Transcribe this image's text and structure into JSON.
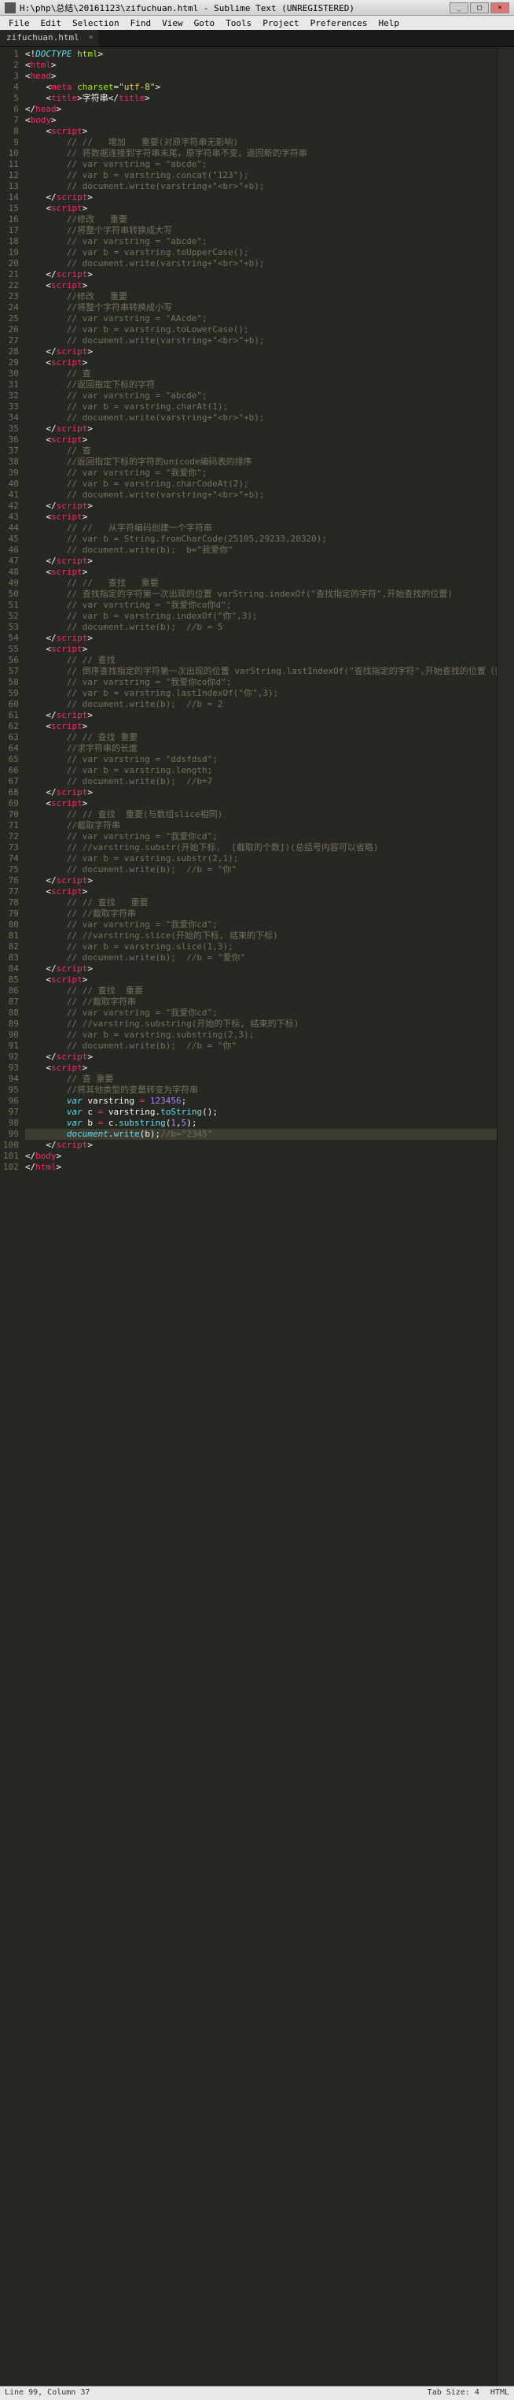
{
  "titlebar": {
    "title": "H:\\php\\总结\\20161123\\zifuchuan.html - Sublime Text (UNREGISTERED)"
  },
  "window_controls": {
    "min": "_",
    "max": "□",
    "close": "×"
  },
  "menu": [
    "File",
    "Edit",
    "Selection",
    "Find",
    "View",
    "Goto",
    "Tools",
    "Project",
    "Preferences",
    "Help"
  ],
  "tab": {
    "name": "zifuchuan.html",
    "close": "×"
  },
  "code": {
    "lines": [
      {
        "n": 1,
        "html": "<span class='t-pun'>&lt;!</span><span class='t-doc'>DOCTYPE</span> <span class='t-attr'>html</span><span class='t-pun'>&gt;</span>"
      },
      {
        "n": 2,
        "html": "<span class='t-pun'>&lt;</span><span class='t-tag'>html</span><span class='t-pun'>&gt;</span>"
      },
      {
        "n": 3,
        "html": "<span class='t-pun'>&lt;</span><span class='t-tag'>head</span><span class='t-pun'>&gt;</span>"
      },
      {
        "n": 4,
        "html": "    <span class='t-pun'>&lt;</span><span class='t-tag'>meta</span> <span class='t-attr'>charset</span><span class='t-pun'>=</span><span class='t-str'>\"utf-8\"</span><span class='t-pun'>&gt;</span>"
      },
      {
        "n": 5,
        "html": "    <span class='t-pun'>&lt;</span><span class='t-tag'>title</span><span class='t-pun'>&gt;</span>字符串<span class='t-pun'>&lt;/</span><span class='t-tag'>title</span><span class='t-pun'>&gt;</span>"
      },
      {
        "n": 6,
        "html": "<span class='t-pun'>&lt;/</span><span class='t-tag'>head</span><span class='t-pun'>&gt;</span>"
      },
      {
        "n": 7,
        "html": "<span class='t-pun'>&lt;</span><span class='t-tag'>body</span><span class='t-pun'>&gt;</span>"
      },
      {
        "n": 8,
        "html": "    <span class='t-pun'>&lt;</span><span class='t-tag'>script</span><span class='t-pun'>&gt;</span>"
      },
      {
        "n": 9,
        "html": "        <span class='t-cmt'>// //   增加   重要(对原字符串无影响)</span>"
      },
      {
        "n": 10,
        "html": "        <span class='t-cmt'>// 将数据连接到字符串末尾，原字符串不变，返回新的字符串</span>"
      },
      {
        "n": 11,
        "html": "        <span class='t-cmt'>// var varstring = \"abcde\";</span>"
      },
      {
        "n": 12,
        "html": "        <span class='t-cmt'>// var b = varstring.concat(\"123\");</span>"
      },
      {
        "n": 13,
        "html": "        <span class='t-cmt'>// document.write(varstring+\"&lt;br&gt;\"+b);</span>"
      },
      {
        "n": 14,
        "html": "    <span class='t-pun'>&lt;/</span><span class='t-tag'>script</span><span class='t-pun'>&gt;</span>"
      },
      {
        "n": 15,
        "html": "    <span class='t-pun'>&lt;</span><span class='t-tag'>script</span><span class='t-pun'>&gt;</span>"
      },
      {
        "n": 16,
        "html": "        <span class='t-cmt'>//修改   重要</span>"
      },
      {
        "n": 17,
        "html": "        <span class='t-cmt'>//将整个字符串转换成大写</span>"
      },
      {
        "n": 18,
        "html": "        <span class='t-cmt'>// var varstring = \"abcde\";</span>"
      },
      {
        "n": 19,
        "html": "        <span class='t-cmt'>// var b = varstring.toUpperCase();</span>"
      },
      {
        "n": 20,
        "html": "        <span class='t-cmt'>// document.write(varstring+\"&lt;br&gt;\"+b);</span>"
      },
      {
        "n": 21,
        "html": "    <span class='t-pun'>&lt;/</span><span class='t-tag'>script</span><span class='t-pun'>&gt;</span>"
      },
      {
        "n": 22,
        "html": "    <span class='t-pun'>&lt;</span><span class='t-tag'>script</span><span class='t-pun'>&gt;</span>"
      },
      {
        "n": 23,
        "html": "        <span class='t-cmt'>//修改   重要</span>"
      },
      {
        "n": 24,
        "html": "        <span class='t-cmt'>//将整个字符串转换成小写</span>"
      },
      {
        "n": 25,
        "html": "        <span class='t-cmt'>// var varstring = \"AAcde\";</span>"
      },
      {
        "n": 26,
        "html": "        <span class='t-cmt'>// var b = varstring.toLowerCase();</span>"
      },
      {
        "n": 27,
        "html": "        <span class='t-cmt'>// document.write(varstring+\"&lt;br&gt;\"+b);</span>"
      },
      {
        "n": 28,
        "html": "    <span class='t-pun'>&lt;/</span><span class='t-tag'>script</span><span class='t-pun'>&gt;</span>"
      },
      {
        "n": 29,
        "html": "    <span class='t-pun'>&lt;</span><span class='t-tag'>script</span><span class='t-pun'>&gt;</span>"
      },
      {
        "n": 30,
        "html": "        <span class='t-cmt'>// 查</span>"
      },
      {
        "n": 31,
        "html": "        <span class='t-cmt'>//返回指定下标的字符</span>"
      },
      {
        "n": 32,
        "html": "        <span class='t-cmt'>// var varstring = \"abcde\";</span>"
      },
      {
        "n": 33,
        "html": "        <span class='t-cmt'>// var b = varstring.charAt(1);</span>"
      },
      {
        "n": 34,
        "html": "        <span class='t-cmt'>// document.write(varstring+\"&lt;br&gt;\"+b);</span>"
      },
      {
        "n": 35,
        "html": "    <span class='t-pun'>&lt;/</span><span class='t-tag'>script</span><span class='t-pun'>&gt;</span>"
      },
      {
        "n": 36,
        "html": "    <span class='t-pun'>&lt;</span><span class='t-tag'>script</span><span class='t-pun'>&gt;</span>"
      },
      {
        "n": 37,
        "html": "        <span class='t-cmt'>// 查</span>"
      },
      {
        "n": 38,
        "html": "        <span class='t-cmt'>//返回指定下标的字符的unicode编码表的排序</span>"
      },
      {
        "n": 39,
        "html": "        <span class='t-cmt'>// var varstring = \"我爱你\";</span>"
      },
      {
        "n": 40,
        "html": "        <span class='t-cmt'>// var b = varstring.charCodeAt(2);</span>"
      },
      {
        "n": 41,
        "html": "        <span class='t-cmt'>// document.write(varstring+\"&lt;br&gt;\"+b);</span>"
      },
      {
        "n": 42,
        "html": "    <span class='t-pun'>&lt;/</span><span class='t-tag'>script</span><span class='t-pun'>&gt;</span>"
      },
      {
        "n": 43,
        "html": "    <span class='t-pun'>&lt;</span><span class='t-tag'>script</span><span class='t-pun'>&gt;</span>"
      },
      {
        "n": 44,
        "html": "        <span class='t-cmt'>// //   从字符编码创建一个字符串</span>"
      },
      {
        "n": 45,
        "html": "        <span class='t-cmt'>// var b = String.fromCharCode(25105,29233,20320);</span>"
      },
      {
        "n": 46,
        "html": "        <span class='t-cmt'>// document.write(b);  b=\"我爱你\"</span>"
      },
      {
        "n": 47,
        "html": "    <span class='t-pun'>&lt;/</span><span class='t-tag'>script</span><span class='t-pun'>&gt;</span>"
      },
      {
        "n": 48,
        "html": "    <span class='t-pun'>&lt;</span><span class='t-tag'>script</span><span class='t-pun'>&gt;</span>"
      },
      {
        "n": 49,
        "html": "        <span class='t-cmt'>// //   查找   重要</span>"
      },
      {
        "n": 50,
        "html": "        <span class='t-cmt'>// 查找指定的字符第一次出现的位置 varString.indexOf(\"查找指定的字符\",开始查找的位置)</span>"
      },
      {
        "n": 51,
        "html": "        <span class='t-cmt'>// var varstring = \"我爱你co你d\";</span>"
      },
      {
        "n": 52,
        "html": "        <span class='t-cmt'>// var b = varstring.indexOf(\"你\",3);</span>"
      },
      {
        "n": 53,
        "html": "        <span class='t-cmt'>// document.write(b);  //b = 5</span>"
      },
      {
        "n": 54,
        "html": "    <span class='t-pun'>&lt;/</span><span class='t-tag'>script</span><span class='t-pun'>&gt;</span>"
      },
      {
        "n": 55,
        "html": "    <span class='t-pun'>&lt;</span><span class='t-tag'>script</span><span class='t-pun'>&gt;</span>"
      },
      {
        "n": 56,
        "html": "        <span class='t-cmt'>// // 查找</span>"
      },
      {
        "n": 57,
        "html": "        <span class='t-cmt'>// 倒序查找指定的字符第一次出现的位置 varString.lastIndexOf(\"查找指定的字符\",开始查找的位置（省去默认从最后一个开始向前找）)</span>"
      },
      {
        "n": 58,
        "html": "        <span class='t-cmt'>// var varstring = \"我爱你co你d\";</span>"
      },
      {
        "n": 59,
        "html": "        <span class='t-cmt'>// var b = varstring.lastIndexOf(\"你\",3);</span>"
      },
      {
        "n": 60,
        "html": "        <span class='t-cmt'>// document.write(b);  //b = 2</span>"
      },
      {
        "n": 61,
        "html": "    <span class='t-pun'>&lt;/</span><span class='t-tag'>script</span><span class='t-pun'>&gt;</span>"
      },
      {
        "n": 62,
        "html": "    <span class='t-pun'>&lt;</span><span class='t-tag'>script</span><span class='t-pun'>&gt;</span>"
      },
      {
        "n": 63,
        "html": "        <span class='t-cmt'>// // 查找 重要</span>"
      },
      {
        "n": 64,
        "html": "        <span class='t-cmt'>//求字符串的长度</span>"
      },
      {
        "n": 65,
        "html": "        <span class='t-cmt'>// var varstring = \"ddsfdsd\";</span>"
      },
      {
        "n": 66,
        "html": "        <span class='t-cmt'>// var b = varstring.length;</span>"
      },
      {
        "n": 67,
        "html": "        <span class='t-cmt'>// document.write(b);  //b=7</span>"
      },
      {
        "n": 68,
        "html": "    <span class='t-pun'>&lt;/</span><span class='t-tag'>script</span><span class='t-pun'>&gt;</span>"
      },
      {
        "n": 69,
        "html": "    <span class='t-pun'>&lt;</span><span class='t-tag'>script</span><span class='t-pun'>&gt;</span>"
      },
      {
        "n": 70,
        "html": "        <span class='t-cmt'>// // 查找  重要(与数组slice相同)</span>"
      },
      {
        "n": 71,
        "html": "        <span class='t-cmt'>//截取字符串</span>"
      },
      {
        "n": 72,
        "html": "        <span class='t-cmt'>// var varstring = \"我爱你cd\";</span>"
      },
      {
        "n": 73,
        "html": "        <span class='t-cmt'>// //varstring.substr(开始下标,  [截取的个数])(总括号内容可以省略)</span>"
      },
      {
        "n": 74,
        "html": "        <span class='t-cmt'>// var b = varstring.substr(2,1);</span>"
      },
      {
        "n": 75,
        "html": "        <span class='t-cmt'>// document.write(b);  //b = \"你\"</span>"
      },
      {
        "n": 76,
        "html": "    <span class='t-pun'>&lt;/</span><span class='t-tag'>script</span><span class='t-pun'>&gt;</span>"
      },
      {
        "n": 77,
        "html": "    <span class='t-pun'>&lt;</span><span class='t-tag'>script</span><span class='t-pun'>&gt;</span>"
      },
      {
        "n": 78,
        "html": "        <span class='t-cmt'>// // 查找   重要</span>"
      },
      {
        "n": 79,
        "html": "        <span class='t-cmt'>// //截取字符串</span>"
      },
      {
        "n": 80,
        "html": "        <span class='t-cmt'>// var varstring = \"我爱你cd\";</span>"
      },
      {
        "n": 81,
        "html": "        <span class='t-cmt'>// //varstring.slice(开始的下标, 结束的下标)</span>"
      },
      {
        "n": 82,
        "html": "        <span class='t-cmt'>// var b = varstring.slice(1,3);</span>"
      },
      {
        "n": 83,
        "html": "        <span class='t-cmt'>// document.write(b);  //b = \"爱你\"</span>"
      },
      {
        "n": 84,
        "html": "    <span class='t-pun'>&lt;/</span><span class='t-tag'>script</span><span class='t-pun'>&gt;</span>"
      },
      {
        "n": 85,
        "html": "    <span class='t-pun'>&lt;</span><span class='t-tag'>script</span><span class='t-pun'>&gt;</span>"
      },
      {
        "n": 86,
        "html": "        <span class='t-cmt'>// // 查找  重要</span>"
      },
      {
        "n": 87,
        "html": "        <span class='t-cmt'>// //截取字符串</span>"
      },
      {
        "n": 88,
        "html": "        <span class='t-cmt'>// var varstring = \"我爱你cd\";</span>"
      },
      {
        "n": 89,
        "html": "        <span class='t-cmt'>// //varstring.substring(开始的下标, 结束的下标)</span>"
      },
      {
        "n": 90,
        "html": "        <span class='t-cmt'>// var b = varstring.substring(2,3);</span>"
      },
      {
        "n": 91,
        "html": "        <span class='t-cmt'>// document.write(b);  //b = \"你\"</span>"
      },
      {
        "n": 92,
        "html": "    <span class='t-pun'>&lt;/</span><span class='t-tag'>script</span><span class='t-pun'>&gt;</span>"
      },
      {
        "n": 93,
        "html": "    <span class='t-pun'>&lt;</span><span class='t-tag'>script</span><span class='t-pun'>&gt;</span>"
      },
      {
        "n": 94,
        "html": "        <span class='t-cmt'>// 查 重要</span>"
      },
      {
        "n": 95,
        "html": "        <span class='t-cmt'>//将其他类型的变量转变为字符串</span>"
      },
      {
        "n": 96,
        "html": "        <span class='t-kw'>var</span> <span class='t-name'>varstring</span> <span class='t-tag'>=</span> <span class='t-num'>123456</span>;"
      },
      {
        "n": 97,
        "html": "        <span class='t-kw'>var</span> <span class='t-name'>c</span> <span class='t-tag'>=</span> varstring.<span class='t-fn'>toString</span>();"
      },
      {
        "n": 98,
        "html": "        <span class='t-kw'>var</span> <span class='t-name'>b</span> <span class='t-tag'>=</span> c.<span class='t-fn'>substring</span>(<span class='t-num'>1</span>,<span class='t-num'>5</span>);"
      },
      {
        "n": 99,
        "html": "        <span class='t-kw'>document</span>.<span class='t-fn'>write</span>(b);<span class='t-cmt'>//b=\"2345\"</span>",
        "hl": true
      },
      {
        "n": 100,
        "html": "    <span class='t-pun'>&lt;/</span><span class='t-tag'>script</span><span class='t-pun'>&gt;</span>"
      },
      {
        "n": 101,
        "html": "<span class='t-pun'>&lt;/</span><span class='t-tag'>body</span><span class='t-pun'>&gt;</span>"
      },
      {
        "n": 102,
        "html": "<span class='t-pun'>&lt;/</span><span class='t-tag'>html</span><span class='t-pun'>&gt;</span>"
      }
    ]
  },
  "status": {
    "position": "Line 99, Column 37",
    "tabsize": "Tab Size: 4",
    "syntax": "HTML"
  }
}
